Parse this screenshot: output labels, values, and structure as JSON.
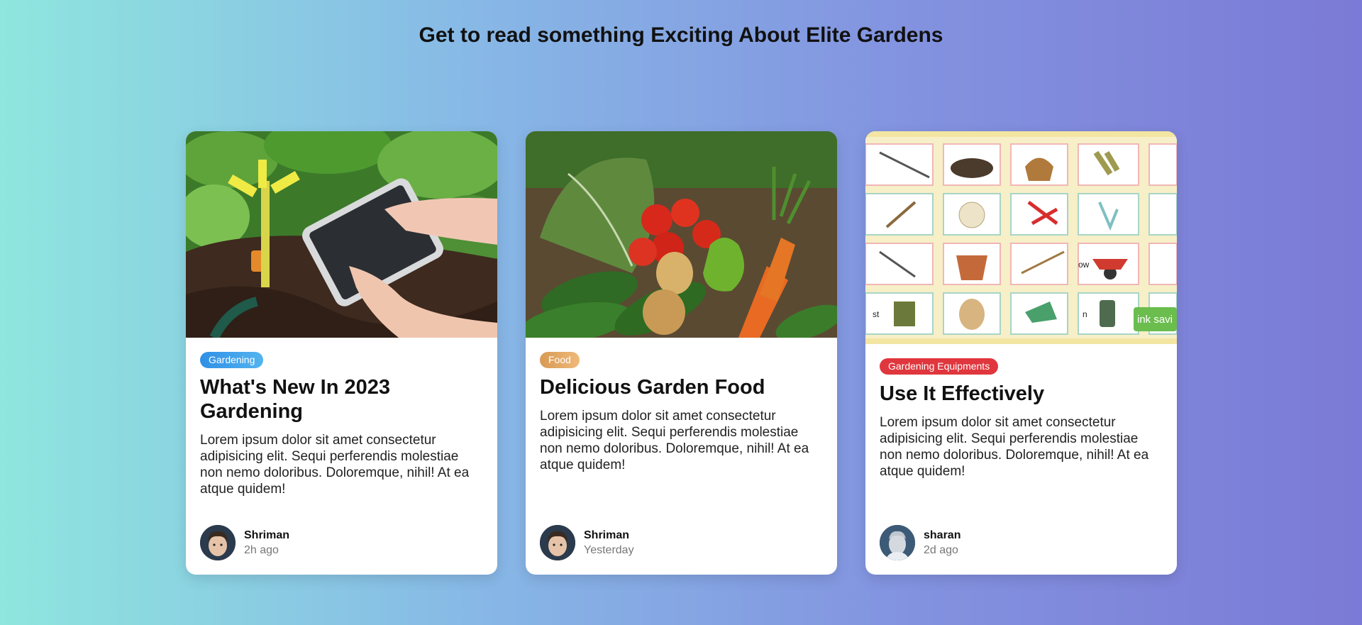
{
  "page": {
    "title": "Get to read something Exciting About Elite Gardens"
  },
  "cards": [
    {
      "tag": "Gardening",
      "tag_color": "#2f8fe6",
      "title": "What's New In 2023 Gardening",
      "text": "Lorem ipsum dolor sit amet consectetur adipisicing elit. Sequi perferendis molestiae non nemo doloribus. Doloremque, nihil! At ea atque quidem!",
      "author": "Shriman",
      "time": "2h ago"
    },
    {
      "tag": "Food",
      "tag_color": "#d79a55",
      "title": "Delicious Garden Food",
      "text": "Lorem ipsum dolor sit amet consectetur adipisicing elit. Sequi perferendis molestiae non nemo doloribus. Doloremque, nihil! At ea atque quidem!",
      "author": "Shriman",
      "time": "Yesterday"
    },
    {
      "tag": "Gardening Equipments",
      "tag_color": "#e0363d",
      "title": "Use It Effectively",
      "text": "Lorem ipsum dolor sit amet consectetur adipisicing elit. Sequi perferendis molestiae non nemo doloribus. Doloremque, nihil! At ea atque quidem!",
      "author": "sharan",
      "time": "2d ago",
      "image_text": [
        "st",
        "ow",
        "n",
        "ink savi"
      ]
    }
  ]
}
